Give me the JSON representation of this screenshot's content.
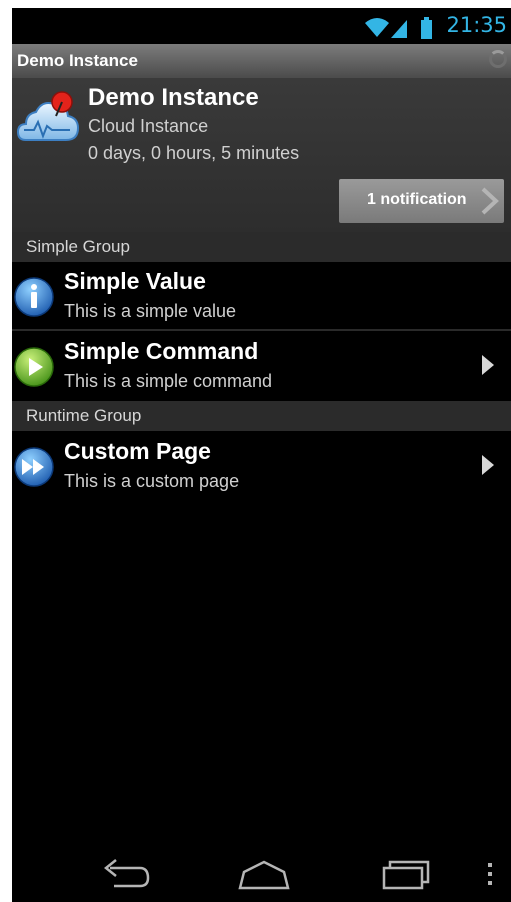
{
  "status_bar": {
    "time": "21:35",
    "icons": [
      "wifi-icon",
      "signal-icon",
      "battery-icon"
    ]
  },
  "title_bar": {
    "title": "Demo Instance"
  },
  "instance": {
    "name": "Demo Instance",
    "type": "Cloud Instance",
    "uptime": "0 days, 0 hours, 5 minutes",
    "notification_button": "1 notification"
  },
  "groups": [
    {
      "label": "Simple Group",
      "items": [
        {
          "title": "Simple Value",
          "subtitle": "This is a simple value",
          "icon": "info-icon",
          "has_arrow": false
        },
        {
          "title": "Simple Command",
          "subtitle": "This is a simple command",
          "icon": "play-icon",
          "has_arrow": true
        }
      ]
    },
    {
      "label": "Runtime Group",
      "items": [
        {
          "title": "Custom Page",
          "subtitle": "This is a custom page",
          "icon": "fast-forward-icon",
          "has_arrow": true
        }
      ]
    }
  ],
  "nav_bar": {
    "buttons": [
      "back-icon",
      "home-icon",
      "recent-apps-icon",
      "menu-overflow-icon"
    ]
  },
  "colors": {
    "accent": "#33b5e5",
    "background": "#000000",
    "group_header": "#2b2b2b"
  }
}
